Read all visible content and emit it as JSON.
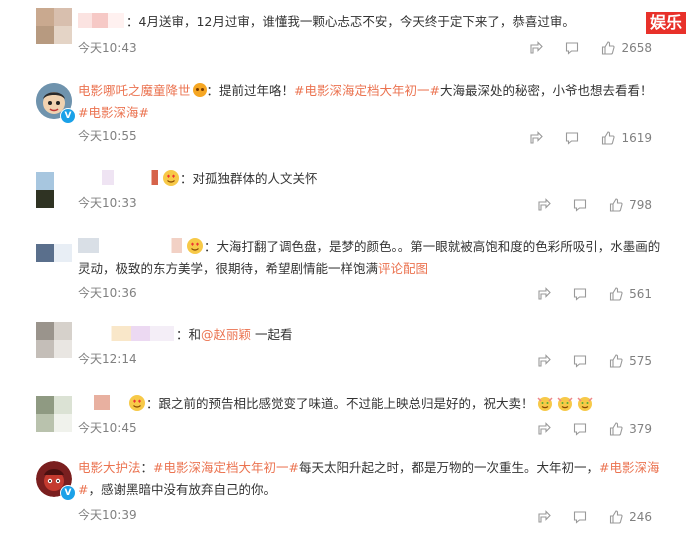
{
  "watermark": "娱乐",
  "comments": [
    {
      "id": 1,
      "user": "",
      "text": "：4月送审，12月过审，谁懂我一颗心忐忑不安，今天终于定下来了，恭喜过审。",
      "time": "今天10:43",
      "likes": "2658"
    },
    {
      "id": 2,
      "user": "电影哪吒之魔童降世",
      "text_prefix": "：提前过年咯！",
      "hashtag1": "#电影深海定档大年初一#",
      "text_mid": "大海最深处的秘密，小爷也想去看看！",
      "hashtag2": "#电影深海#",
      "time": "今天10:55",
      "likes": "1619"
    },
    {
      "id": 3,
      "user": "",
      "text": "：对孤独群体的人文关怀",
      "time": "今天10:33",
      "likes": "798"
    },
    {
      "id": 4,
      "user": "",
      "text": "：大海打翻了调色盘，是梦的颜色。。第一眼就被高饱和度的色彩所吸引，水墨画的灵动，极致的东方美学，很期待，希望剧情能一样饱满",
      "link": "评论配图",
      "time": "今天10:36",
      "likes": "561"
    },
    {
      "id": 5,
      "user": "",
      "text_prefix": "：和",
      "mention": "@赵丽颖",
      "text_suffix": " 一起看",
      "time": "今天12:14",
      "likes": "575"
    },
    {
      "id": 6,
      "user": "",
      "text": "：跟之前的预告相比感觉变了味道。不过能上映总归是好的，祝大卖！",
      "time": "今天10:45",
      "likes": "379"
    },
    {
      "id": 7,
      "user": "电影大护法",
      "text_prefix": "：",
      "hashtag1": "#电影深海定档大年初一#",
      "text_mid": "每天太阳升起之时，都是万物的一次重生。大年初一，",
      "hashtag2": "#电影深海#",
      "text_suffix": "，感谢黑暗中没有放弃自己的你。",
      "time": "今天10:39",
      "likes": "246"
    }
  ],
  "icons": {
    "share": "share-icon",
    "comment": "comment-icon",
    "like": "thumbs-up-icon"
  },
  "colors": {
    "accent": "#eb7350",
    "meta": "#808080",
    "watermark": "#e8312a"
  }
}
